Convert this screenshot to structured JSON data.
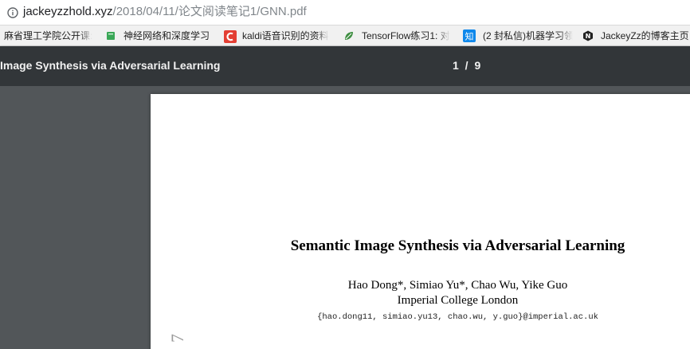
{
  "address_bar": {
    "url_host": "jackeyzzhold.xyz",
    "url_path": "/2018/04/11/论文阅读笔记1/GNN.pdf"
  },
  "bookmarks": [
    {
      "label": "麻省理工学院公开课:",
      "icon": "none"
    },
    {
      "label": "神经网络和深度学习",
      "icon": "green-book-icon"
    },
    {
      "label": "kaldi语音识别的资料",
      "icon": "csdn-icon"
    },
    {
      "label": "TensorFlow练习1: 对",
      "icon": "leaf-icon"
    },
    {
      "label": "(2 封私信)机器学习领",
      "icon": "zhihu-icon"
    },
    {
      "label": "JackeyZz的博客主页",
      "icon": "hexagon-n-icon"
    }
  ],
  "pdf_toolbar": {
    "title": "Image Synthesis via Adversarial Learning",
    "page_indicator": "1 / 9"
  },
  "paper": {
    "title": "Semantic Image Synthesis via Adversarial Learning",
    "authors": "Hao Dong*, Simiao Yu*, Chao Wu, Yike Guo",
    "affiliation": "Imperial College London",
    "email": "{hao.dong11, simiao.yu13, chao.wu, y.guo}@imperial.ac.uk",
    "side_stamp": "7"
  },
  "colors": {
    "toolbar_bg": "#323639",
    "viewer_bg": "#525659",
    "page_bg": "#ffffff",
    "bookmark_bar_bg": "#f1f1f1"
  }
}
